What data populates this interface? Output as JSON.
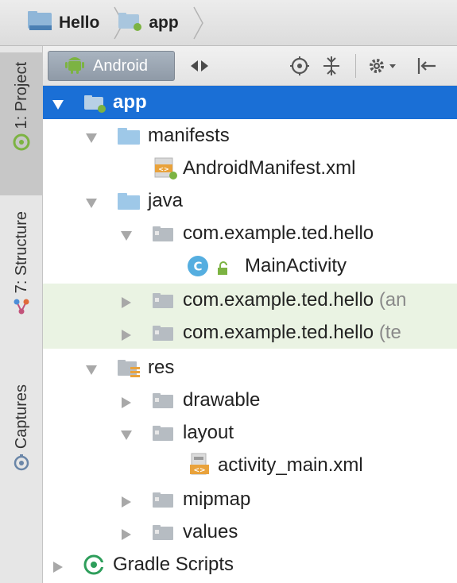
{
  "breadcrumb": {
    "items": [
      {
        "label": "Hello"
      },
      {
        "label": "app"
      }
    ]
  },
  "sidebar": {
    "tabs": [
      {
        "label": "1: Project"
      },
      {
        "label": "7: Structure"
      },
      {
        "label": "Captures"
      }
    ]
  },
  "toolbar": {
    "view_label": "Android"
  },
  "tree": {
    "app": "app",
    "manifests": "manifests",
    "android_manifest": "AndroidManifest.xml",
    "java": "java",
    "pkg_main": "com.example.ted.hello",
    "main_activity": "MainActivity",
    "class_badge": "C",
    "pkg_android_test": "com.example.ted.hello",
    "pkg_android_test_suffix": "(an",
    "pkg_test": "com.example.ted.hello",
    "pkg_test_suffix": "(te",
    "res": "res",
    "drawable": "drawable",
    "layout": "layout",
    "activity_main": "activity_main.xml",
    "mipmap": "mipmap",
    "values": "values",
    "gradle_scripts": "Gradle Scripts",
    "xml_badge": "<>"
  },
  "colors": {
    "selection": "#1a6fd6",
    "test_row": "#eaf3e3",
    "folder": "#9ec8e8",
    "package_folder": "#b6bcc2",
    "android_green": "#7cb342",
    "gradle_green": "#2e9e5b",
    "class_blue": "#55aee0"
  }
}
